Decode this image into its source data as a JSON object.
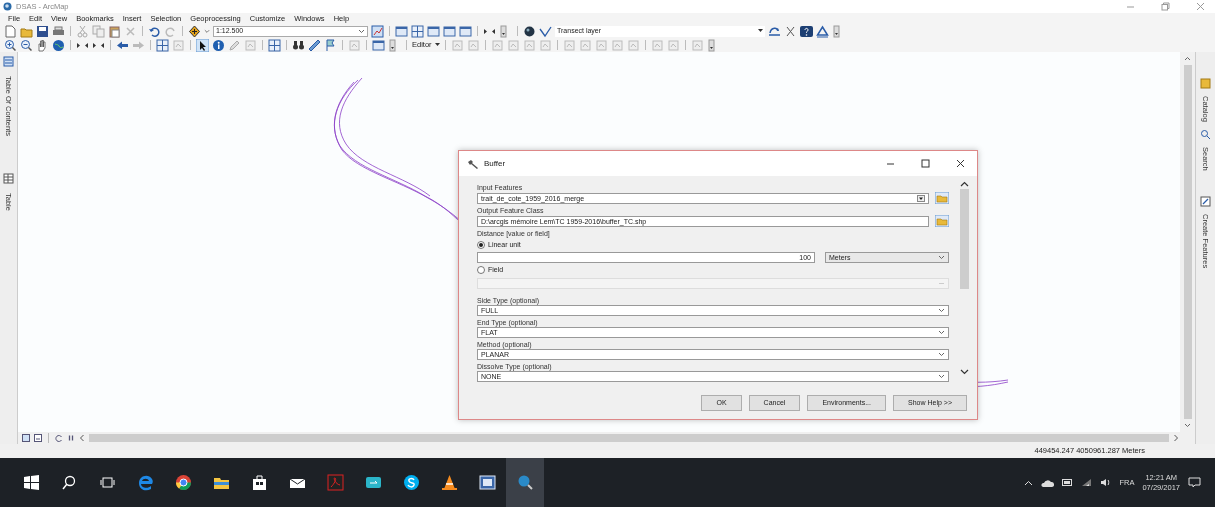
{
  "window": {
    "title": "DSAS - ArcMap"
  },
  "menu": [
    "File",
    "Edit",
    "View",
    "Bookmarks",
    "Insert",
    "Selection",
    "Geoprocessing",
    "Customize",
    "Windows",
    "Help"
  ],
  "toolbar": {
    "scale": "1:12.500",
    "target_layer": "Transect layer",
    "editor": "Editor"
  },
  "left_dock": [
    "Table Of Contents",
    "Table"
  ],
  "right_dock": [
    "Catalog",
    "Search",
    "Create Features"
  ],
  "dialog": {
    "title": "Buffer",
    "params": [
      {
        "kind": "dropdown-browse",
        "label": "Input Features",
        "value": "trait_de_cote_1959_2016_merge"
      },
      {
        "kind": "text-browse",
        "label": "Output Feature Class",
        "value": "D:\\arcgis mémoire Lem\\TC 1959-2016\\buffer_TC.shp"
      },
      {
        "kind": "heading",
        "label": "Distance [value or field]"
      },
      {
        "kind": "radio",
        "label": "Linear unit",
        "selected": true
      },
      {
        "kind": "number-unit",
        "value": "100",
        "unit": "Meters"
      },
      {
        "kind": "radio",
        "label": "Field",
        "selected": false
      },
      {
        "kind": "field-select",
        "disabled": true
      },
      {
        "kind": "dropdown",
        "label": "Side Type (optional)",
        "value": "FULL"
      },
      {
        "kind": "dropdown",
        "label": "End Type (optional)",
        "value": "FLAT"
      },
      {
        "kind": "dropdown",
        "label": "Method (optional)",
        "value": "PLANAR"
      },
      {
        "kind": "dropdown",
        "label": "Dissolve Type (optional)",
        "value": "NONE"
      }
    ],
    "buttons": [
      "OK",
      "Cancel",
      "Environments...",
      "Show Help >>"
    ]
  },
  "status_bar": {
    "coordinates": "449454.247  4050961.287 Meters"
  },
  "taskbar": {
    "language": "FRA",
    "time": "12:21 AM",
    "date": "07/29/2017"
  }
}
